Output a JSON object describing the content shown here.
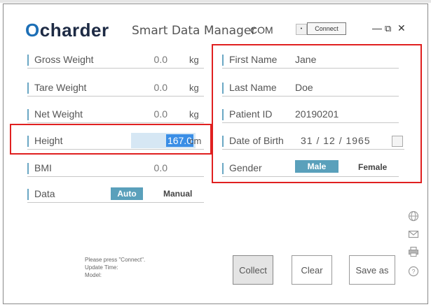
{
  "header": {
    "logo_o": "O",
    "logo_text": "charder",
    "app_title": "Smart Data Manager",
    "com_label": "COM",
    "dropdown_glyph": "•",
    "connect_label": "Connect",
    "minimize": "—",
    "restore": "⧉",
    "close": "✕"
  },
  "measurements": {
    "gross_weight": {
      "label": "Gross Weight",
      "value": "0.0",
      "unit": "kg"
    },
    "tare_weight": {
      "label": "Tare Weight",
      "value": "0.0",
      "unit": "kg"
    },
    "net_weight": {
      "label": "Net Weight",
      "value": "0.0",
      "unit": "kg"
    },
    "height": {
      "label": "Height",
      "value": "167.0",
      "unit": "cm"
    },
    "bmi": {
      "label": "BMI",
      "value": "0.0"
    },
    "data": {
      "label": "Data",
      "auto": "Auto",
      "manual": "Manual",
      "selected": "Auto"
    }
  },
  "patient": {
    "first_name": {
      "label": "First Name",
      "value": "Jane"
    },
    "last_name": {
      "label": "Last Name",
      "value": "Doe"
    },
    "patient_id": {
      "label": "Patient ID",
      "value": "20190201"
    },
    "dob": {
      "label": "Date of Birth",
      "value": "31  /  12  /  1965"
    },
    "gender": {
      "label": "Gender",
      "male": "Male",
      "female": "Female",
      "selected": "Male"
    }
  },
  "status": {
    "line1": "Please press \"Connect\".",
    "line2": "Update Time:",
    "line3": "Model:"
  },
  "actions": {
    "collect": "Collect",
    "clear": "Clear",
    "save_as": "Save as"
  },
  "side_icons": [
    "globe-icon",
    "mail-icon",
    "printer-icon",
    "help-icon"
  ],
  "colors": {
    "accent": "#5aa0bb",
    "highlight": "#e02020",
    "selection": "#3a8ee6",
    "logo_blue": "#1d6fb6"
  }
}
